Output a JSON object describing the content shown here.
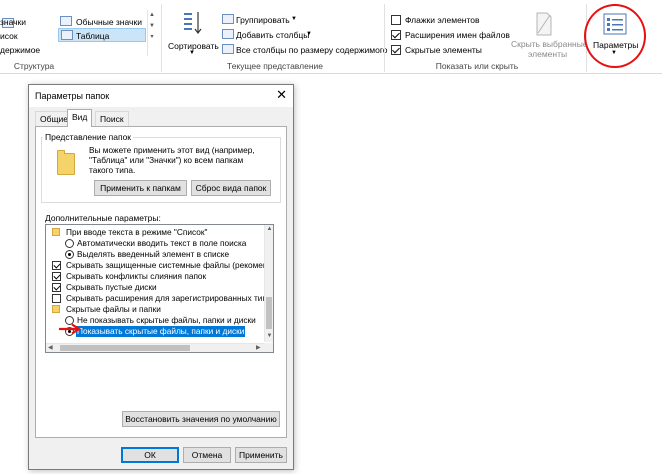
{
  "ribbon": {
    "layout_group": {
      "items": [
        {
          "label": "значки",
          "icon": "large-icons-icon"
        },
        {
          "label": "Обычные значки",
          "icon": "medium-icons-icon"
        },
        {
          "label": "исок",
          "icon": "list-icon"
        },
        {
          "label": "Таблица",
          "icon": "details-icon",
          "selected": true
        },
        {
          "label": "держимое",
          "icon": "content-icon"
        }
      ],
      "label": "Структура"
    },
    "current_view": {
      "sort_label": "Сортировать",
      "group_by": "Группировать",
      "add_columns": "Добавить столбцы",
      "fit_columns": "Все столбцы по размеру содержимого",
      "label": "Текущее представление"
    },
    "show_hide": {
      "item_checkboxes": "Флажки элементов",
      "file_extensions": "Расширения имен файлов",
      "hidden_items": "Скрытые элементы",
      "hide_selected_line1": "Скрыть выбранные",
      "hide_selected_line2": "элементы",
      "label": "Показать или скрыть"
    },
    "options_label": "Параметры"
  },
  "dialog": {
    "title": "Параметры папок",
    "tabs": [
      "Общие",
      "Вид",
      "Поиск"
    ],
    "folder_views": {
      "title": "Представление папок",
      "description": [
        "Вы можете применить этот вид (например,",
        "\"Таблица\" или \"Значки\") ко всем папкам",
        "такого типа."
      ],
      "apply_button": "Применить к папкам",
      "reset_button": "Сброс вида папок"
    },
    "advanced_title": "Дополнительные параметры:",
    "advanced_items": [
      {
        "type": "folder",
        "label": "При вводе текста в режиме \"Список\""
      },
      {
        "type": "radio",
        "checked": false,
        "label": "Автоматически вводить текст в поле поиска"
      },
      {
        "type": "radio",
        "checked": true,
        "label": "Выделять введенный элемент в списке"
      },
      {
        "type": "checkbox",
        "checked": true,
        "label": "Скрывать защищенные системные файлы (рекомен"
      },
      {
        "type": "checkbox",
        "checked": true,
        "label": "Скрывать конфликты слияния папок"
      },
      {
        "type": "checkbox",
        "checked": true,
        "label": "Скрывать пустые диски"
      },
      {
        "type": "checkbox",
        "checked": false,
        "label": "Скрывать расширения для зарегистрированных типо"
      },
      {
        "type": "folder",
        "label": "Скрытые файлы и папки"
      },
      {
        "type": "radio",
        "checked": false,
        "label": "Не показывать скрытые файлы, папки и диски"
      },
      {
        "type": "radio",
        "checked": true,
        "selected": true,
        "label": "Показывать скрытые файлы, папки и диски"
      }
    ],
    "restore_button": "Восстановить значения по умолчанию",
    "ok_button": "ОК",
    "cancel_button": "Отмена",
    "apply_button": "Применить",
    "close_glyph": "✕"
  },
  "colors": {
    "selection": "#0078d7",
    "annotation": "#e81010",
    "folder": "#f5d36b"
  }
}
